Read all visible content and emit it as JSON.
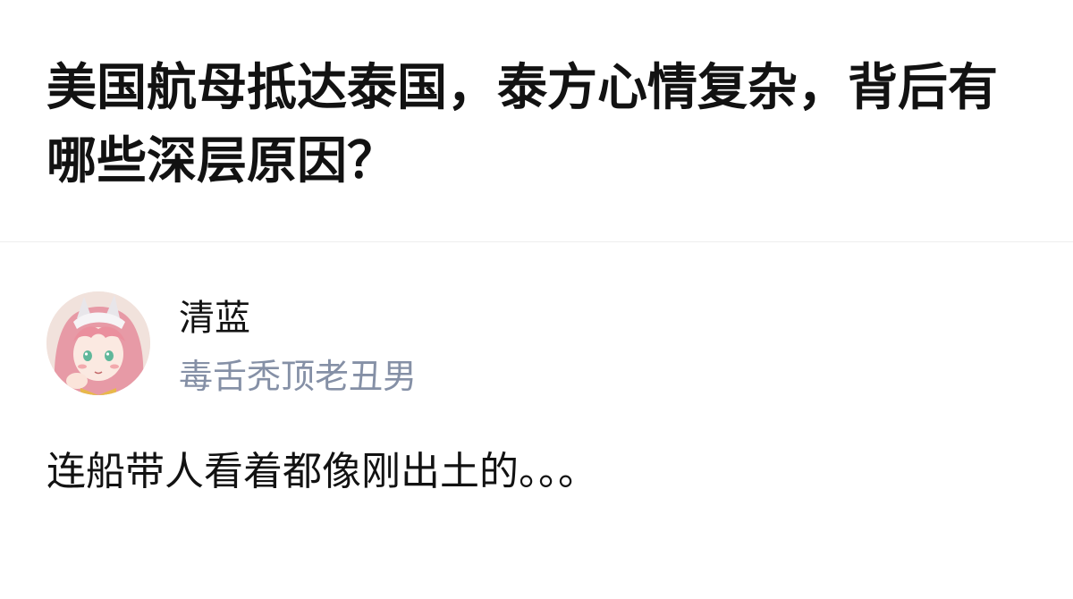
{
  "question": {
    "title": "美国航母抵达泰国，泰方心情复杂，背后有哪些深层原因？"
  },
  "answer": {
    "author": {
      "name": "清蓝",
      "bio": "毒舌秃顶老丑男",
      "avatar_icon": "anime-girl-avatar"
    },
    "content": "连船带人看着都像刚出土的。。。"
  },
  "colors": {
    "title": "#121212",
    "bio": "#8590a6",
    "divider": "#ededed"
  }
}
